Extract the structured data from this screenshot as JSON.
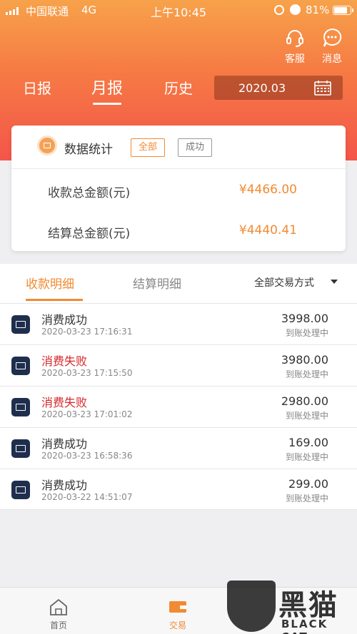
{
  "status_bar": {
    "carrier": "中国联通",
    "network": "4G",
    "time": "上午10:45",
    "battery": "81%"
  },
  "header": {
    "service_label": "客服",
    "message_label": "消息",
    "tabs": [
      "日报",
      "月报",
      "历史"
    ],
    "active_tab": "月报",
    "date_value": "2020.03"
  },
  "stats_card": {
    "title": "数据统计",
    "filters": [
      "全部",
      "成功"
    ],
    "active_filter": "全部",
    "rows": [
      {
        "label": "收款总金额(元)",
        "value": "¥4466.00"
      },
      {
        "label": "结算总金额(元)",
        "value": "¥4440.41"
      }
    ]
  },
  "subtabs": {
    "items": [
      "收款明细",
      "结算明细"
    ],
    "active": "收款明细",
    "filter_label": "全部交易方式"
  },
  "transactions": [
    {
      "name": "消费成功",
      "time": "2020-03-23 17:16:31",
      "amount": "3998.00",
      "status": "到账处理中",
      "failed": false
    },
    {
      "name": "消费失败",
      "time": "2020-03-23 17:15:50",
      "amount": "3980.00",
      "status": "到账处理中",
      "failed": true
    },
    {
      "name": "消费失败",
      "time": "2020-03-23 17:01:02",
      "amount": "2980.00",
      "status": "到账处理中",
      "failed": true
    },
    {
      "name": "消费成功",
      "time": "2020-03-23 16:58:36",
      "amount": "169.00",
      "status": "到账处理中",
      "failed": false
    },
    {
      "name": "消费成功",
      "time": "2020-03-22 14:51:07",
      "amount": "299.00",
      "status": "到账处理中",
      "failed": false
    }
  ],
  "bottom_nav": {
    "home_label": "首页",
    "trade_label": "交易",
    "active": "交易"
  },
  "watermark": {
    "cn": "黑猫",
    "en": "BLACK CAT"
  },
  "colors": {
    "accent": "#f28a32",
    "fail": "#d8272a",
    "header_top": "#f7a24a",
    "header_bottom": "#f3554a"
  },
  "icons": {
    "service": "headset-icon",
    "message": "chat-bubble-icon",
    "calendar": "calendar-icon",
    "card": "bank-card-icon",
    "home": "home-icon",
    "trade": "wallet-icon"
  }
}
